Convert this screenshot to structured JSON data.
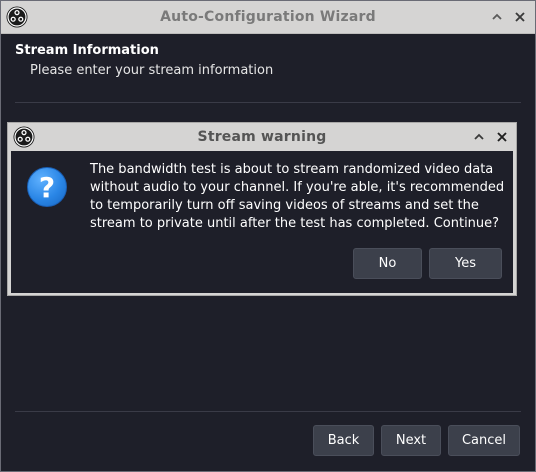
{
  "window": {
    "title": "Auto-Configuration Wizard",
    "minimize_glyph": "^",
    "close_glyph": "✕"
  },
  "header": {
    "title": "Stream Information",
    "subtitle": "Please enter your stream information"
  },
  "footer": {
    "back_label": "Back",
    "next_label": "Next",
    "cancel_label": "Cancel"
  },
  "dialog": {
    "title": "Stream warning",
    "icon_glyph": "?",
    "message": "The bandwidth test is about to stream randomized video data without audio to your channel. If you're able, it's recommended to temporarily turn off saving videos of streams and set the stream to private until after the test has completed. Continue?",
    "no_label": "No",
    "yes_label": "Yes"
  },
  "colors": {
    "background": "#1e1f29",
    "titlebar": "#d5d4d3",
    "button": "#3c404b",
    "question_icon": "#2a86e6"
  },
  "icons": [
    "obs-logo-icon",
    "chevron-up-icon",
    "close-icon",
    "question-icon"
  ]
}
